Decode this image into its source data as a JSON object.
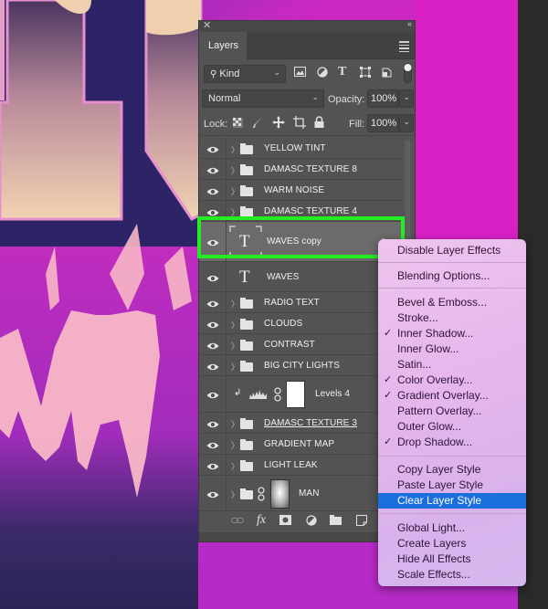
{
  "panel": {
    "title": "Layers",
    "filter": {
      "label": "Kind",
      "icon": "search-icon"
    },
    "filter_icons": [
      "pixel-layer-filter-icon",
      "adjustment-layer-filter-icon",
      "type-layer-filter-icon",
      "shape-layer-filter-icon",
      "smart-object-filter-icon",
      "filter-toggle-icon"
    ],
    "blend_mode": "Normal",
    "opacity_label": "Opacity:",
    "opacity_value": "100%",
    "lock_label": "Lock:",
    "fill_label": "Fill:",
    "fill_value": "100%",
    "type_glyph": "T",
    "bottom_icons": [
      "link-layers-icon",
      "fx-icon",
      "add-mask-icon",
      "adjustment-icon",
      "new-group-icon",
      "new-layer-icon"
    ],
    "fx_glyph": "fx"
  },
  "layers": [
    {
      "name": "YELLOW TINT",
      "type": "group"
    },
    {
      "name": "DAMASC TEXTURE 8",
      "type": "group"
    },
    {
      "name": "WARM NOISE",
      "type": "group"
    },
    {
      "name": "DAMASC TEXTURE 4",
      "type": "group"
    },
    {
      "name": "WAVES copy",
      "type": "text",
      "selected": true,
      "has_fx": true
    },
    {
      "name": "WAVES",
      "type": "text"
    },
    {
      "name": "RADIO TEXT",
      "type": "group"
    },
    {
      "name": "CLOUDS",
      "type": "group"
    },
    {
      "name": "CONTRAST",
      "type": "group"
    },
    {
      "name": "BIG CITY LIGHTS",
      "type": "group"
    },
    {
      "name": "Levels 4",
      "type": "adjustment"
    },
    {
      "name": "DAMASC TEXTURE 3",
      "type": "group"
    },
    {
      "name": "GRADIENT MAP",
      "type": "group"
    },
    {
      "name": "LIGHT LEAK",
      "type": "group"
    },
    {
      "name": "MAN",
      "type": "group-masked"
    }
  ],
  "context_menu": {
    "items": [
      {
        "label": "Disable Layer Effects",
        "checked": false
      },
      {
        "label": "Blending Options...",
        "checked": false
      },
      {
        "label": "Bevel & Emboss...",
        "checked": false
      },
      {
        "label": "Stroke...",
        "checked": false
      },
      {
        "label": "Inner Shadow...",
        "checked": true
      },
      {
        "label": "Inner Glow...",
        "checked": false
      },
      {
        "label": "Satin...",
        "checked": false
      },
      {
        "label": "Color Overlay...",
        "checked": true
      },
      {
        "label": "Gradient Overlay...",
        "checked": true
      },
      {
        "label": "Pattern Overlay...",
        "checked": false
      },
      {
        "label": "Outer Glow...",
        "checked": false
      },
      {
        "label": "Drop Shadow...",
        "checked": true
      },
      {
        "label": "Copy Layer Style",
        "checked": false
      },
      {
        "label": "Paste Layer Style",
        "checked": false
      },
      {
        "label": "Clear Layer Style",
        "checked": false,
        "highlighted": true
      },
      {
        "label": "Global Light...",
        "checked": false
      },
      {
        "label": "Create Layers",
        "checked": false
      },
      {
        "label": "Hide All Effects",
        "checked": false
      },
      {
        "label": "Scale Effects...",
        "checked": false
      }
    ],
    "check_glyph": "✓"
  },
  "colors": {
    "selection_outline": "#22ee22",
    "menu_highlight": "#1b6fdc",
    "panel_bg": "#535353"
  }
}
